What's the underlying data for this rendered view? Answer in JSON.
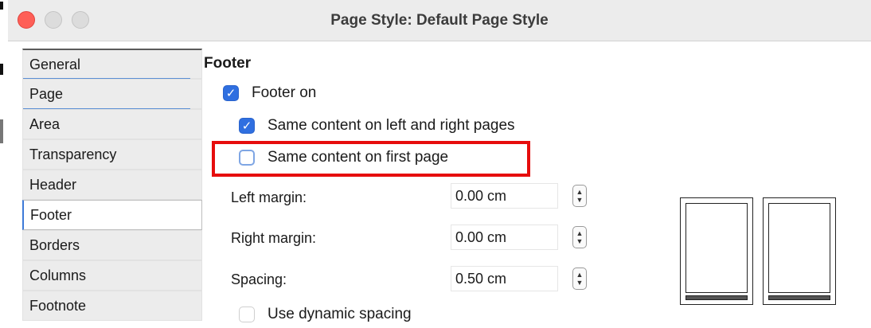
{
  "window": {
    "title": "Page Style: Default Page Style"
  },
  "tabs": [
    {
      "label": "General"
    },
    {
      "label": "Page"
    },
    {
      "label": "Area"
    },
    {
      "label": "Transparency"
    },
    {
      "label": "Header"
    },
    {
      "label": "Footer",
      "active": true
    },
    {
      "label": "Borders"
    },
    {
      "label": "Columns"
    },
    {
      "label": "Footnote"
    }
  ],
  "footer": {
    "section_title": "Footer",
    "footer_on": {
      "label": "Footer on",
      "checked": true
    },
    "same_left_right": {
      "label": "Same content on left and right pages",
      "checked": true
    },
    "same_first_page": {
      "label": "Same content on first page",
      "checked": false
    },
    "left_margin": {
      "label": "Left margin:",
      "value": "0.00 cm"
    },
    "right_margin": {
      "label": "Right margin:",
      "value": "0.00 cm"
    },
    "spacing": {
      "label": "Spacing:",
      "value": "0.50 cm"
    },
    "dynamic_spacing": {
      "label": "Use dynamic spacing",
      "checked": false
    }
  },
  "icons": {
    "checkmark": "✓",
    "spin_up": "▲",
    "spin_down": "▼"
  },
  "colors": {
    "accent": "#2f6fe0",
    "highlight": "#e60d0d",
    "close": "#fe5f57"
  }
}
